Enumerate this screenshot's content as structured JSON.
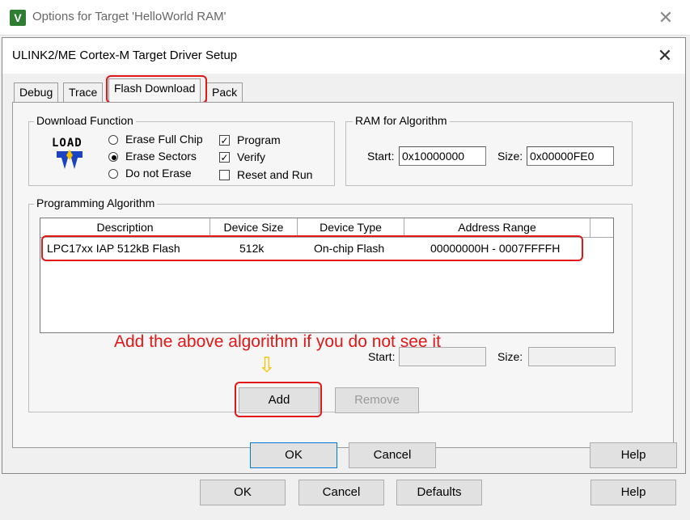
{
  "outer_window": {
    "title": "Options for Target 'HelloWorld RAM'",
    "icon_glyph": "V",
    "close_glyph": "✕",
    "buttons": {
      "ok": "OK",
      "cancel": "Cancel",
      "defaults": "Defaults",
      "help": "Help"
    }
  },
  "dialog": {
    "title": "ULINK2/ME Cortex-M Target Driver Setup",
    "close_glyph": "✕",
    "tabs": [
      {
        "label": "Debug",
        "active": false
      },
      {
        "label": "Trace",
        "active": false
      },
      {
        "label": "Flash Download",
        "active": true
      },
      {
        "label": "Pack",
        "active": false
      }
    ],
    "download_function": {
      "label": "Download Function",
      "load_icon_text": "LOAD",
      "radios": [
        {
          "label": "Erase Full Chip",
          "selected": false
        },
        {
          "label": "Erase Sectors",
          "selected": true
        },
        {
          "label": "Do not Erase",
          "selected": false
        }
      ],
      "checkboxes": [
        {
          "label": "Program",
          "checked": true,
          "mark": "✓"
        },
        {
          "label": "Verify",
          "checked": true,
          "mark": "✓"
        },
        {
          "label": "Reset and Run",
          "checked": false,
          "mark": ""
        }
      ]
    },
    "ram_for_algorithm": {
      "label": "RAM for Algorithm",
      "start_label": "Start:",
      "start_value": "0x10000000",
      "size_label": "Size:",
      "size_value": "0x00000FE0"
    },
    "programming_algorithm": {
      "label": "Programming Algorithm",
      "columns": [
        "Description",
        "Device Size",
        "Device Type",
        "Address Range"
      ],
      "rows": [
        {
          "description": "LPC17xx IAP 512kB Flash",
          "device_size": "512k",
          "device_type": "On-chip Flash",
          "address_range": "00000000H - 0007FFFFH"
        }
      ],
      "start_label": "Start:",
      "start_value": "",
      "size_label": "Size:",
      "size_value": ""
    },
    "buttons": {
      "add": "Add",
      "remove": "Remove",
      "ok": "OK",
      "cancel": "Cancel",
      "help": "Help"
    },
    "annotation": "Add the above algorithm if you do not see it",
    "annotation_arrow": "⇩",
    "colors": {
      "highlight": "#e01818",
      "arrow": "#f5c400",
      "load_icon": "#1a44c2"
    }
  }
}
